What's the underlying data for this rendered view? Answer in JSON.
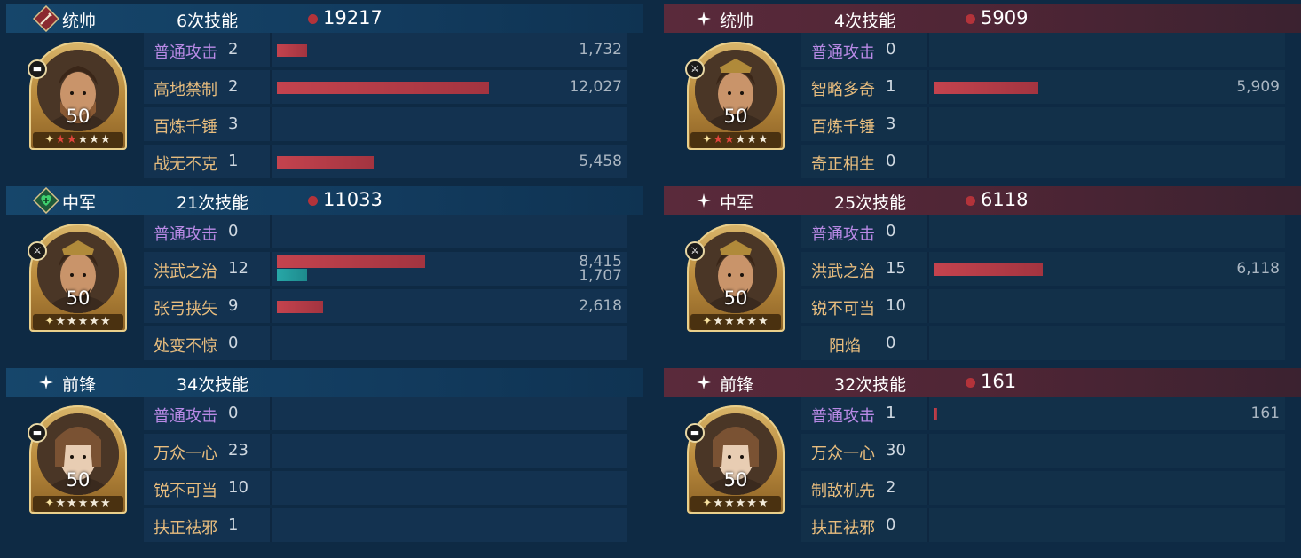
{
  "left": {
    "blocks": [
      {
        "role": "统帅",
        "casts": "6次技能",
        "stats": [
          {
            "color": "red",
            "value": "19217"
          }
        ],
        "portrait": {
          "level": "50",
          "stars": "★★★★★",
          "red_stars": 2,
          "badge": "tank-icon"
        },
        "skills": [
          {
            "name": "普通攻击",
            "count": "2",
            "damage": "1,732",
            "fraction": 0.144,
            "basic": true
          },
          {
            "name": "高地禁制",
            "count": "2",
            "damage": "12,027",
            "fraction": 1.0
          },
          {
            "name": "百炼千锤",
            "count": "3"
          },
          {
            "name": "战无不克",
            "count": "1",
            "damage": "5,458",
            "fraction": 0.454
          }
        ]
      },
      {
        "role": "中军",
        "casts": "21次技能",
        "stats": [
          {
            "color": "red",
            "value": "11033"
          },
          {
            "color": "green",
            "value": "1707"
          }
        ],
        "portrait": {
          "level": "50",
          "stars": "★★★★★",
          "red_stars": 0,
          "badge": "sword-icon"
        },
        "skills": [
          {
            "name": "普通攻击",
            "count": "0",
            "basic": true
          },
          {
            "name": "洪武之治",
            "count": "12",
            "damage": "8,415",
            "fraction": 0.7,
            "heal": "1,707",
            "heal_fraction": 0.142
          },
          {
            "name": "张弓挟矢",
            "count": "9",
            "damage": "2,618",
            "fraction": 0.218
          },
          {
            "name": "处变不惊",
            "count": "0"
          }
        ]
      },
      {
        "role": "前锋",
        "casts": "34次技能",
        "stats": [],
        "portrait": {
          "level": "50",
          "stars": "★★★★★",
          "red_stars": 0,
          "badge": "tank-icon"
        },
        "skills": [
          {
            "name": "普通攻击",
            "count": "0",
            "basic": true
          },
          {
            "name": "万众一心",
            "count": "23"
          },
          {
            "name": "锐不可当",
            "count": "10"
          },
          {
            "name": "扶正祛邪",
            "count": "1"
          }
        ]
      }
    ]
  },
  "right": {
    "blocks": [
      {
        "role": "统帅",
        "casts": "4次技能",
        "stats": [
          {
            "color": "red",
            "value": "5909"
          }
        ],
        "portrait": {
          "level": "50",
          "stars": "★★★★★",
          "red_stars": 2,
          "badge": "sword-icon"
        },
        "skills": [
          {
            "name": "普通攻击",
            "count": "0",
            "basic": true
          },
          {
            "name": "智略多奇",
            "count": "1",
            "damage": "5,909",
            "fraction": 0.491
          },
          {
            "name": "百炼千锤",
            "count": "3"
          },
          {
            "name": "奇正相生",
            "count": "0"
          }
        ]
      },
      {
        "role": "中军",
        "casts": "25次技能",
        "stats": [
          {
            "color": "red",
            "value": "6118"
          }
        ],
        "portrait": {
          "level": "50",
          "stars": "★★★★★",
          "red_stars": 0,
          "badge": "sword-icon"
        },
        "skills": [
          {
            "name": "普通攻击",
            "count": "0",
            "basic": true
          },
          {
            "name": "洪武之治",
            "count": "15",
            "damage": "6,118",
            "fraction": 0.509
          },
          {
            "name": "锐不可当",
            "count": "10"
          },
          {
            "name": "阳焰",
            "count": "0",
            "indent": true
          }
        ]
      },
      {
        "role": "前锋",
        "casts": "32次技能",
        "stats": [
          {
            "color": "red",
            "value": "161"
          }
        ],
        "portrait": {
          "level": "50",
          "stars": "★★★★★",
          "red_stars": 0,
          "badge": "tank-icon"
        },
        "skills": [
          {
            "name": "普通攻击",
            "count": "1",
            "damage": "161",
            "fraction": 0.013,
            "basic": true
          },
          {
            "name": "万众一心",
            "count": "30"
          },
          {
            "name": "制敌机先",
            "count": "2"
          },
          {
            "name": "扶正祛邪",
            "count": "0"
          }
        ]
      }
    ]
  }
}
